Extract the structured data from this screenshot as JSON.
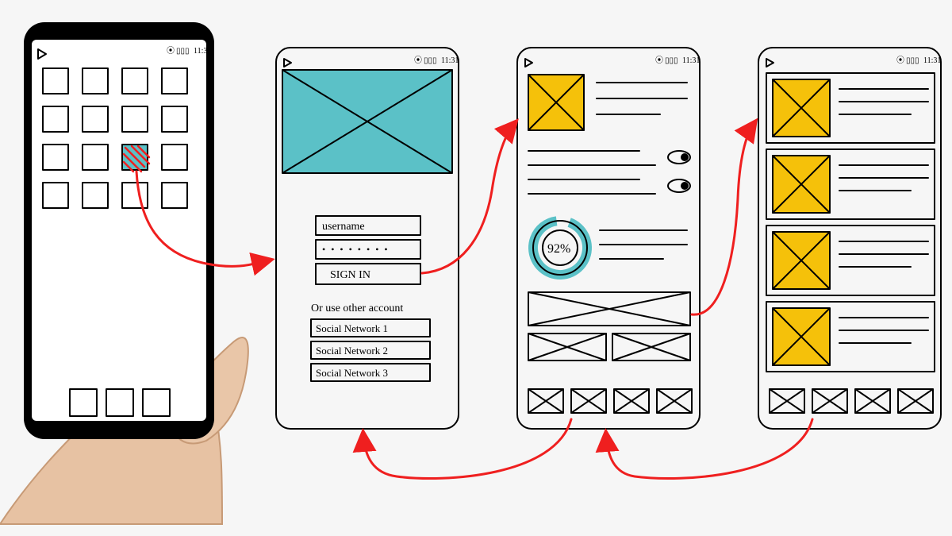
{
  "status_bar": {
    "time": "11:31"
  },
  "screen_login": {
    "username_label": "username",
    "password_value": "• • • • • • • •",
    "signin_label": "SIGN IN",
    "alt_account_label": "Or use other account",
    "social_1": "Social Network 1",
    "social_2": "Social Network 2",
    "social_3": "Social Network 3"
  },
  "screen_dashboard": {
    "progress_percent": "92%"
  },
  "colors": {
    "teal": "#5bc1c7",
    "yellow": "#f5c10a",
    "arrow": "#ef1f1f"
  }
}
